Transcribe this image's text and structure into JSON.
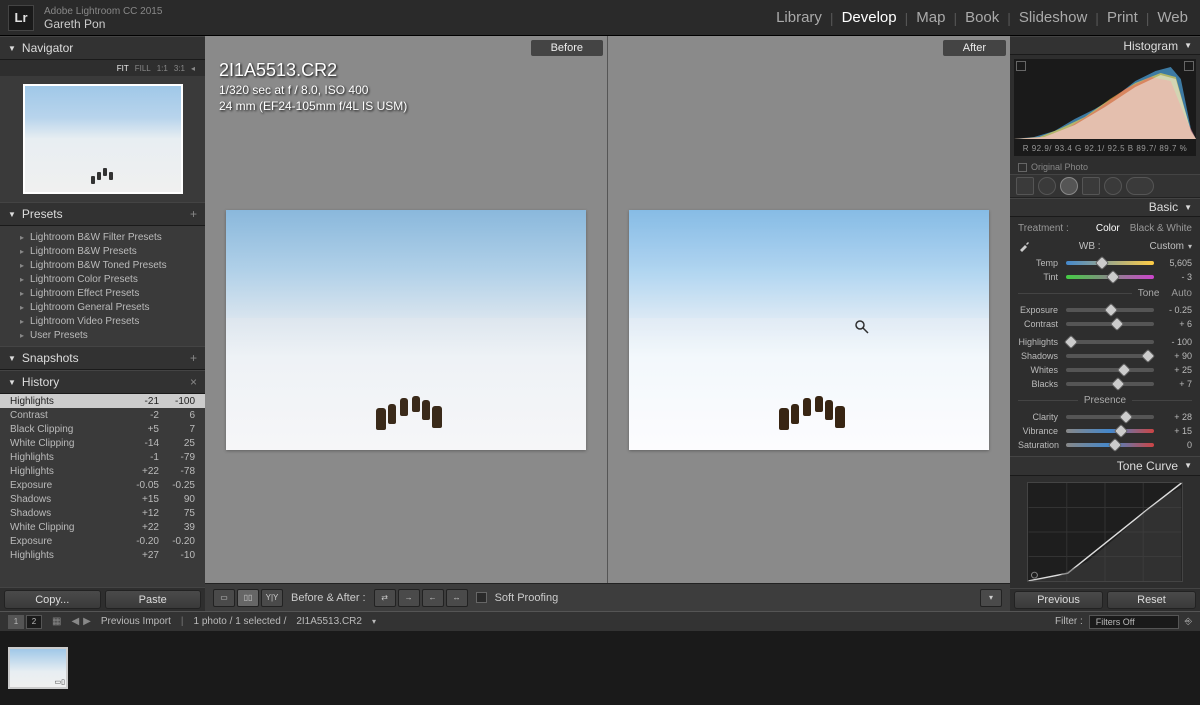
{
  "app": {
    "name": "Adobe Lightroom CC 2015",
    "user": "Gareth Pon"
  },
  "modules": [
    "Library",
    "Develop",
    "Map",
    "Book",
    "Slideshow",
    "Print",
    "Web"
  ],
  "active_module": "Develop",
  "navigator": {
    "title": "Navigator",
    "zoom_modes": [
      "FIT",
      "FILL",
      "1:1",
      "3:1"
    ]
  },
  "presets": {
    "title": "Presets",
    "items": [
      "Lightroom B&W Filter Presets",
      "Lightroom B&W Presets",
      "Lightroom B&W Toned Presets",
      "Lightroom Color Presets",
      "Lightroom Effect Presets",
      "Lightroom General Presets",
      "Lightroom Video Presets",
      "User Presets"
    ]
  },
  "snapshots": {
    "title": "Snapshots"
  },
  "history": {
    "title": "History",
    "rows": [
      {
        "label": "Highlights",
        "v1": "-21",
        "v2": "-100",
        "sel": true
      },
      {
        "label": "Contrast",
        "v1": "-2",
        "v2": "6"
      },
      {
        "label": "Black Clipping",
        "v1": "+5",
        "v2": "7"
      },
      {
        "label": "White Clipping",
        "v1": "-14",
        "v2": "25"
      },
      {
        "label": "Highlights",
        "v1": "-1",
        "v2": "-79"
      },
      {
        "label": "Highlights",
        "v1": "+22",
        "v2": "-78"
      },
      {
        "label": "Exposure",
        "v1": "-0.05",
        "v2": "-0.25"
      },
      {
        "label": "Shadows",
        "v1": "+15",
        "v2": "90"
      },
      {
        "label": "Shadows",
        "v1": "+12",
        "v2": "75"
      },
      {
        "label": "White Clipping",
        "v1": "+22",
        "v2": "39"
      },
      {
        "label": "Exposure",
        "v1": "-0.20",
        "v2": "-0.20"
      },
      {
        "label": "Highlights",
        "v1": "+27",
        "v2": "-10"
      }
    ]
  },
  "copy_paste": {
    "copy": "Copy...",
    "paste": "Paste"
  },
  "viewer": {
    "before_label": "Before",
    "after_label": "After",
    "filename": "2I1A5513.CR2",
    "exposure_line": "1/320 sec at f / 8.0, ISO 400",
    "lens_line": "24 mm (EF24-105mm f/4L IS USM)"
  },
  "center_toolbar": {
    "before_after_label": "Before & After :",
    "soft_proofing": "Soft Proofing"
  },
  "histogram": {
    "title": "Histogram",
    "rgb": "R 92.9/ 93.4  G 92.1/ 92.5  B 89.7/ 89.7 %",
    "original_photo": "Original Photo"
  },
  "basic": {
    "title": "Basic",
    "treatment_label": "Treatment :",
    "treat_color": "Color",
    "treat_bw": "Black & White",
    "wb_label": "WB :",
    "wb_value": "Custom",
    "temp_label": "Temp",
    "temp_value": "5,605",
    "tint_label": "Tint",
    "tint_value": "- 3",
    "tone_label": "Tone",
    "auto_label": "Auto",
    "exposure_label": "Exposure",
    "exposure_value": "- 0.25",
    "contrast_label": "Contrast",
    "contrast_value": "+ 6",
    "highlights_label": "Highlights",
    "highlights_value": "- 100",
    "shadows_label": "Shadows",
    "shadows_value": "+ 90",
    "whites_label": "Whites",
    "whites_value": "+ 25",
    "blacks_label": "Blacks",
    "blacks_value": "+ 7",
    "presence_label": "Presence",
    "clarity_label": "Clarity",
    "clarity_value": "+ 28",
    "vibrance_label": "Vibrance",
    "vibrance_value": "+ 15",
    "saturation_label": "Saturation",
    "saturation_value": "0"
  },
  "tone_curve": {
    "title": "Tone Curve"
  },
  "prev_reset": {
    "previous": "Previous",
    "reset": "Reset"
  },
  "filmstrip_bar": {
    "source": "Previous Import",
    "count": "1 photo / 1 selected /",
    "filename": "2I1A5513.CR2",
    "filter_label": "Filter :",
    "filter_value": "Filters Off"
  },
  "cell_sizes": [
    "1",
    "2"
  ]
}
